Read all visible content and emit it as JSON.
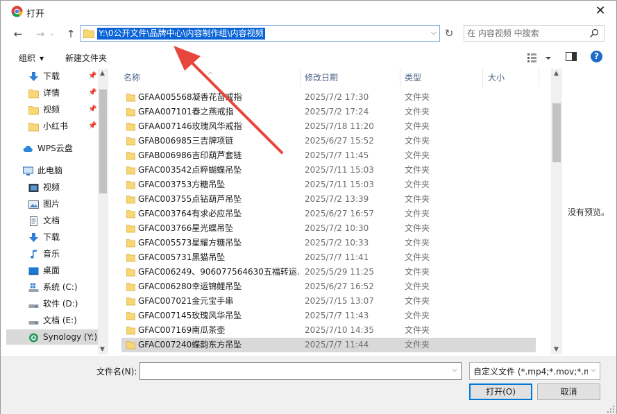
{
  "window": {
    "title": "打开",
    "close_glyph": "✕"
  },
  "nav": {
    "back_glyph": "←",
    "forward_glyph": "→",
    "recent_glyph": "⌄",
    "up_glyph": "↑",
    "address_path": "Y:\\0公开文件\\品牌中心\\内容制作组\\内容视频",
    "refresh_glyph": "↻",
    "search_placeholder": "在 内容视频 中搜索"
  },
  "toolbar": {
    "organize_label": "组织",
    "new_folder_label": "新建文件夹",
    "help_label": "?"
  },
  "sidebar": {
    "items": [
      {
        "label": "下载",
        "icon": "download-arrow-icon",
        "pinned": true
      },
      {
        "label": "详情",
        "icon": "folder-icon",
        "pinned": true
      },
      {
        "label": "视频",
        "icon": "folder-icon",
        "pinned": true
      },
      {
        "label": "小红书",
        "icon": "folder-icon",
        "pinned": true
      },
      {
        "label": "WPS云盘",
        "icon": "cloud-icon",
        "pinned": false
      },
      {
        "label": "此电脑",
        "icon": "computer-icon",
        "pinned": false
      },
      {
        "label": "视频",
        "icon": "video-library-icon",
        "pinned": false
      },
      {
        "label": "图片",
        "icon": "pictures-library-icon",
        "pinned": false
      },
      {
        "label": "文档",
        "icon": "documents-library-icon",
        "pinned": false
      },
      {
        "label": "下载",
        "icon": "download-arrow-icon",
        "pinned": false
      },
      {
        "label": "音乐",
        "icon": "music-note-icon",
        "pinned": false
      },
      {
        "label": "桌面",
        "icon": "desktop-icon",
        "pinned": false
      },
      {
        "label": "系统 (C:)",
        "icon": "system-drive-icon",
        "pinned": false
      },
      {
        "label": "软件 (D:)",
        "icon": "drive-icon",
        "pinned": false
      },
      {
        "label": "文档 (E:)",
        "icon": "drive-icon",
        "pinned": false
      },
      {
        "label": "Synology (Y:)",
        "icon": "network-drive-icon",
        "pinned": false
      }
    ],
    "selected_index": 15,
    "pin_glyph": "📌"
  },
  "columns": {
    "name": "名称",
    "date": "修改日期",
    "type": "类型",
    "size": "大小"
  },
  "files": [
    {
      "name": "GFAA005568凝香花苗戒指",
      "date": "2025/7/2 17:30",
      "type": "文件夹"
    },
    {
      "name": "GFAA007101春之燕戒指",
      "date": "2025/7/2 17:24",
      "type": "文件夹"
    },
    {
      "name": "GFAA007146玫瑰风华戒指",
      "date": "2025/7/18 11:20",
      "type": "文件夹"
    },
    {
      "name": "GFAB006985三吉牌项链",
      "date": "2025/6/27 15:52",
      "type": "文件夹"
    },
    {
      "name": "GFAB006986吉印葫芦套链",
      "date": "2025/7/7 11:45",
      "type": "文件夹"
    },
    {
      "name": "GFAC003542点粹蝴蝶吊坠",
      "date": "2025/7/11 15:03",
      "type": "文件夹"
    },
    {
      "name": "GFAC003753方糖吊坠",
      "date": "2025/7/11 15:03",
      "type": "文件夹"
    },
    {
      "name": "GFAC003755点钻葫芦吊坠",
      "date": "2025/7/2 13:39",
      "type": "文件夹"
    },
    {
      "name": "GFAC003764有求必应吊坠",
      "date": "2025/6/27 16:57",
      "type": "文件夹"
    },
    {
      "name": "GFAC003766星光蝶吊坠",
      "date": "2025/7/2 10:30",
      "type": "文件夹"
    },
    {
      "name": "GFAC005573星耀方糖吊坠",
      "date": "2025/7/2 10:33",
      "type": "文件夹"
    },
    {
      "name": "GFAC005731黑猫吊坠",
      "date": "2025/7/7 11:41",
      "type": "文件夹"
    },
    {
      "name": "GFAC006249、906077564630五福转运...",
      "date": "2025/5/29 11:25",
      "type": "文件夹"
    },
    {
      "name": "GFAC006280幸运锦鲤吊坠",
      "date": "2025/6/27 16:52",
      "type": "文件夹"
    },
    {
      "name": "GFAC007021金元宝手串",
      "date": "2025/7/15 13:07",
      "type": "文件夹"
    },
    {
      "name": "GFAC007145玫瑰风华吊坠",
      "date": "2025/7/7 11:43",
      "type": "文件夹"
    },
    {
      "name": "GFAC007169南瓜茶壶",
      "date": "2025/7/10 14:35",
      "type": "文件夹"
    },
    {
      "name": "GFAC007240蝶韵东方吊坠",
      "date": "2025/7/7 11:44",
      "type": "文件夹"
    }
  ],
  "selected_file_index": 17,
  "preview": {
    "empty_text": "没有预览。"
  },
  "bottom": {
    "filename_label": "文件名(N):",
    "filename_value": "",
    "filetype_value": "自定义文件 (*.mp4;*.mov;*.mkv",
    "open_label": "打开(O)",
    "cancel_label": "取消"
  },
  "colors": {
    "selection_blue": "#0a64d8",
    "folder_yellow": "#f8d775",
    "annotation_red": "#e8453c",
    "header_text": "#4d6185",
    "help_blue": "#1c6ac9"
  }
}
